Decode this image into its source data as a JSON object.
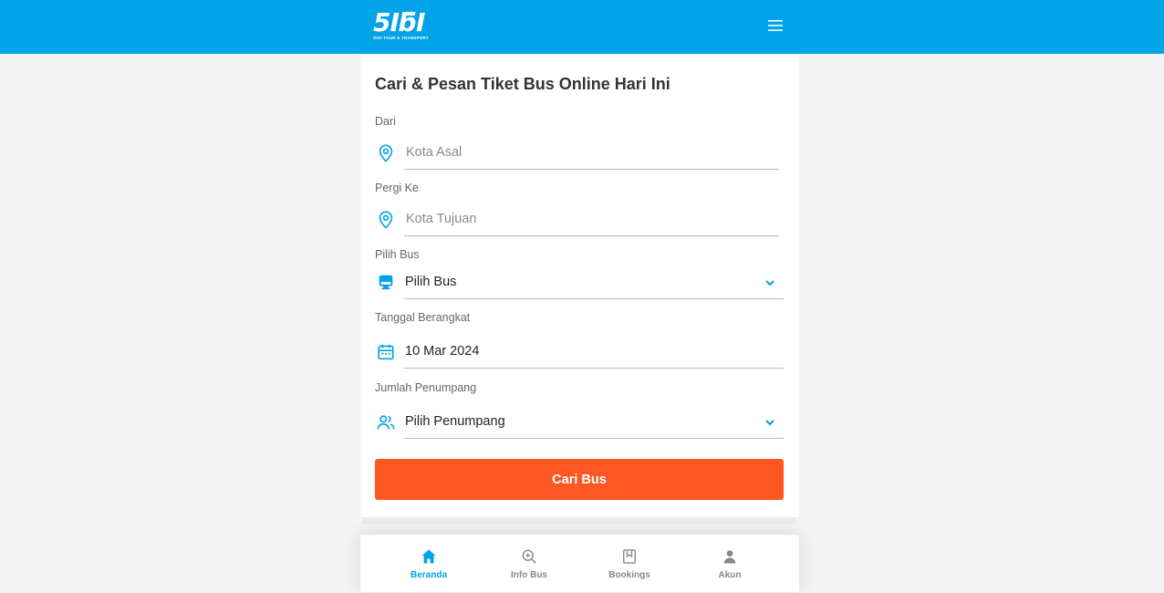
{
  "header": {
    "logo_text": "5IƃI",
    "logo_subtitle": "SIGI TOUR & TRANSPORT",
    "menu_icon": "hamburger-menu-icon",
    "color": "#00a3e8"
  },
  "form": {
    "title": "Cari & Pesan Tiket Bus Online Hari Ini",
    "origin": {
      "label": "Dari",
      "placeholder": "Kota Asal",
      "icon": "location-pin-icon"
    },
    "destination": {
      "label": "Pergi Ke",
      "placeholder": "Kota Tujuan",
      "icon": "location-pin-icon"
    },
    "bus": {
      "label": "Pilih Bus",
      "value": "Pilih Bus",
      "icon": "bus-icon"
    },
    "date": {
      "label": "Tanggal Berangkat",
      "value": "10 Mar 2024",
      "icon": "calendar-icon"
    },
    "passengers": {
      "label": "Jumlah Penumpang",
      "value": "Pilih Penumpang",
      "icon": "users-icon"
    },
    "search_button": "Cari Bus",
    "accent_color": "#ff5722"
  },
  "bottom_nav": {
    "items": [
      {
        "label": "Beranda",
        "icon": "home-icon",
        "active": true
      },
      {
        "label": "Info Bus",
        "icon": "zoom-icon",
        "active": false
      },
      {
        "label": "Bookings",
        "icon": "bookmark-icon",
        "active": false
      },
      {
        "label": "Akun",
        "icon": "user-icon",
        "active": false
      }
    ]
  }
}
